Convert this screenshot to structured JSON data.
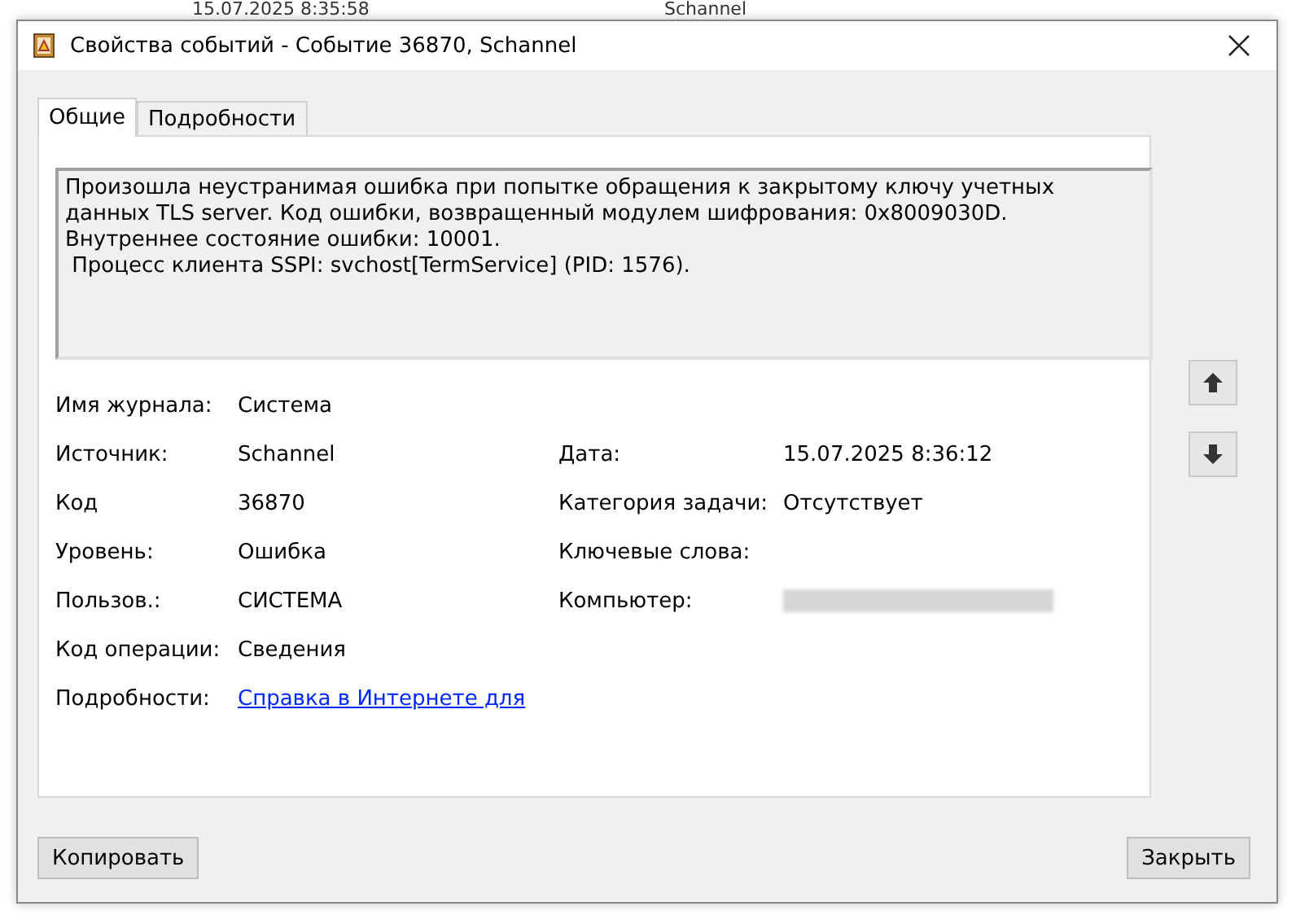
{
  "background_window": {
    "texts": [
      "15.07.2025 8:35:58",
      "Schannel"
    ]
  },
  "window": {
    "title": "Свойства событий - Событие 36870, Schannel"
  },
  "tabs": [
    {
      "label": "Общие",
      "selected": true
    },
    {
      "label": "Подробности",
      "selected": false
    }
  ],
  "description": [
    "Произошла неустранимая ошибка при попытке обращения к закрытому ключу учетных",
    "данных TLS server. Код ошибки, возвращенный модулем шифрования: 0x8009030D.",
    "Внутреннее состояние ошибки: 10001.",
    " Процесс клиента SSPI: svchost[TermService] (PID: 1576)."
  ],
  "fields": [
    {
      "left": {
        "label": "Имя журнала:",
        "kind": "text",
        "value": "Система"
      }
    },
    {
      "left": {
        "label": "Источник:",
        "kind": "text",
        "value": "Schannel"
      },
      "right": {
        "label": "Дата:",
        "kind": "text",
        "value": "15.07.2025 8:36:12"
      }
    },
    {
      "left": {
        "label": "Код",
        "kind": "text",
        "value": "36870"
      },
      "right": {
        "label": "Категория задачи:",
        "kind": "text",
        "value": "Отсутствует"
      }
    },
    {
      "left": {
        "label": "Уровень:",
        "kind": "text",
        "value": "Ошибка"
      },
      "right": {
        "label": "Ключевые слова:",
        "kind": "empty"
      }
    },
    {
      "left": {
        "label": "Пользов.:",
        "kind": "text",
        "value": "СИСТЕМА"
      },
      "right": {
        "label": "Компьютер:",
        "kind": "redacted"
      }
    },
    {
      "left": {
        "label": "Код операции:",
        "kind": "text",
        "value": "Сведения"
      }
    },
    {
      "left": {
        "label": "Подробности:",
        "kind": "link",
        "value": "Справка в Интернете для"
      }
    }
  ],
  "buttons": {
    "copy": "Копировать",
    "close": "Закрыть"
  }
}
